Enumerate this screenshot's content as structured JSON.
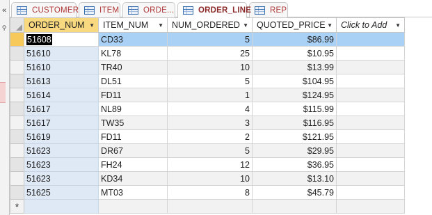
{
  "tabs": [
    {
      "label": "CUSTOMER",
      "active": false
    },
    {
      "label": "ITEM",
      "active": false
    },
    {
      "label": "ORDE...",
      "active": false
    },
    {
      "label": "ORDER_LINE",
      "active": true
    },
    {
      "label": "REP",
      "active": false
    }
  ],
  "nav": {
    "chevron_icon": "«",
    "search_icon": "search-icon"
  },
  "grid": {
    "columns": [
      "ORDER_NUM",
      "ITEM_NUM",
      "NUM_ORDERED",
      "QUOTED_PRICE",
      "Click to Add"
    ],
    "rows": [
      {
        "order_num": "51608",
        "item_num": "CD33",
        "num_ordered": "5",
        "quoted_price": "$86.99"
      },
      {
        "order_num": "51610",
        "item_num": "KL78",
        "num_ordered": "25",
        "quoted_price": "$10.95"
      },
      {
        "order_num": "51610",
        "item_num": "TR40",
        "num_ordered": "10",
        "quoted_price": "$13.99"
      },
      {
        "order_num": "51613",
        "item_num": "DL51",
        "num_ordered": "5",
        "quoted_price": "$104.95"
      },
      {
        "order_num": "51614",
        "item_num": "FD11",
        "num_ordered": "1",
        "quoted_price": "$124.95"
      },
      {
        "order_num": "51617",
        "item_num": "NL89",
        "num_ordered": "4",
        "quoted_price": "$115.99"
      },
      {
        "order_num": "51617",
        "item_num": "TW35",
        "num_ordered": "3",
        "quoted_price": "$116.95"
      },
      {
        "order_num": "51619",
        "item_num": "FD11",
        "num_ordered": "2",
        "quoted_price": "$121.95"
      },
      {
        "order_num": "51623",
        "item_num": "DR67",
        "num_ordered": "5",
        "quoted_price": "$29.95"
      },
      {
        "order_num": "51623",
        "item_num": "FH24",
        "num_ordered": "12",
        "quoted_price": "$36.95"
      },
      {
        "order_num": "51623",
        "item_num": "KD34",
        "num_ordered": "10",
        "quoted_price": "$13.10"
      },
      {
        "order_num": "51625",
        "item_num": "MT03",
        "num_ordered": "8",
        "quoted_price": "$45.79"
      }
    ],
    "new_record_marker": "*"
  },
  "colors": {
    "tab_text": "#b03838",
    "selected_column_header": "#f9d97f",
    "current_row": "#a9d0f5"
  }
}
